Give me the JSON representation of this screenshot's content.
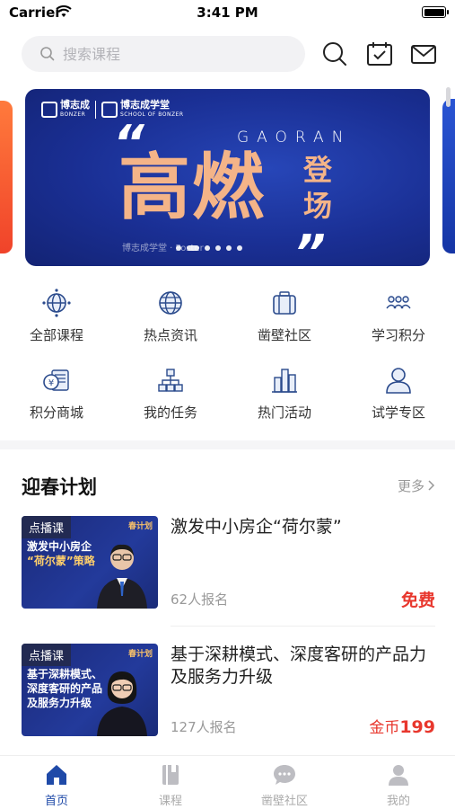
{
  "status_bar": {
    "carrier": "Carrier",
    "time": "3:41 PM"
  },
  "search": {
    "placeholder": "搜索课程"
  },
  "header_icons": [
    "search-icon",
    "calendar-check-icon",
    "mail-icon"
  ],
  "banner": {
    "logo_left": "博志成",
    "logo_left_sub": "BONZER",
    "logo_right": "博志成学堂",
    "logo_right_sub": "SCHOOL OF BONZER",
    "headline": "高燃",
    "subtitle": "登场",
    "english": "GAORAN",
    "footer": "博志成学堂 · Poster",
    "slide_count": 6,
    "active_slide": 1
  },
  "grid": [
    {
      "label": "全部课程",
      "icon": "globe-orbit-icon"
    },
    {
      "label": "热点资讯",
      "icon": "globe-icon"
    },
    {
      "label": "凿壁社区",
      "icon": "suitcase-icon"
    },
    {
      "label": "学习积分",
      "icon": "group-icon"
    },
    {
      "label": "积分商城",
      "icon": "yen-card-icon"
    },
    {
      "label": "我的任务",
      "icon": "org-chart-icon"
    },
    {
      "label": "热门活动",
      "icon": "buildings-icon"
    },
    {
      "label": "试学专区",
      "icon": "user-icon"
    }
  ],
  "section": {
    "title": "迎春计划",
    "more": "更多"
  },
  "courses": [
    {
      "tag": "点播课",
      "thumb_brand": "春计划",
      "thumb_line1": "激发中小房企",
      "thumb_line2": "“荷尔蒙”策略",
      "title": "激发中小房企“荷尔蒙”",
      "count": "62人报名",
      "price": "免费"
    },
    {
      "tag": "点播课",
      "thumb_brand": "春计划",
      "thumb_line1": "基于深耕模式、",
      "thumb_line2": "深度客研的产品",
      "thumb_line3": "及服务力升级",
      "title": "基于深耕模式、深度客研的产品力及服务力升级",
      "count": "127人报名",
      "price_prefix": "金币",
      "price_value": "199"
    }
  ],
  "tabbar": [
    {
      "label": "首页",
      "icon": "home-icon",
      "active": true
    },
    {
      "label": "课程",
      "icon": "book-icon",
      "active": false
    },
    {
      "label": "凿壁社区",
      "icon": "chat-icon",
      "active": false
    },
    {
      "label": "我的",
      "icon": "profile-icon",
      "active": false
    }
  ],
  "colors": {
    "accent": "#1f4aa8",
    "price": "#e8372d",
    "banner_bg": "#1a2f94",
    "banner_text": "#f4b488"
  }
}
